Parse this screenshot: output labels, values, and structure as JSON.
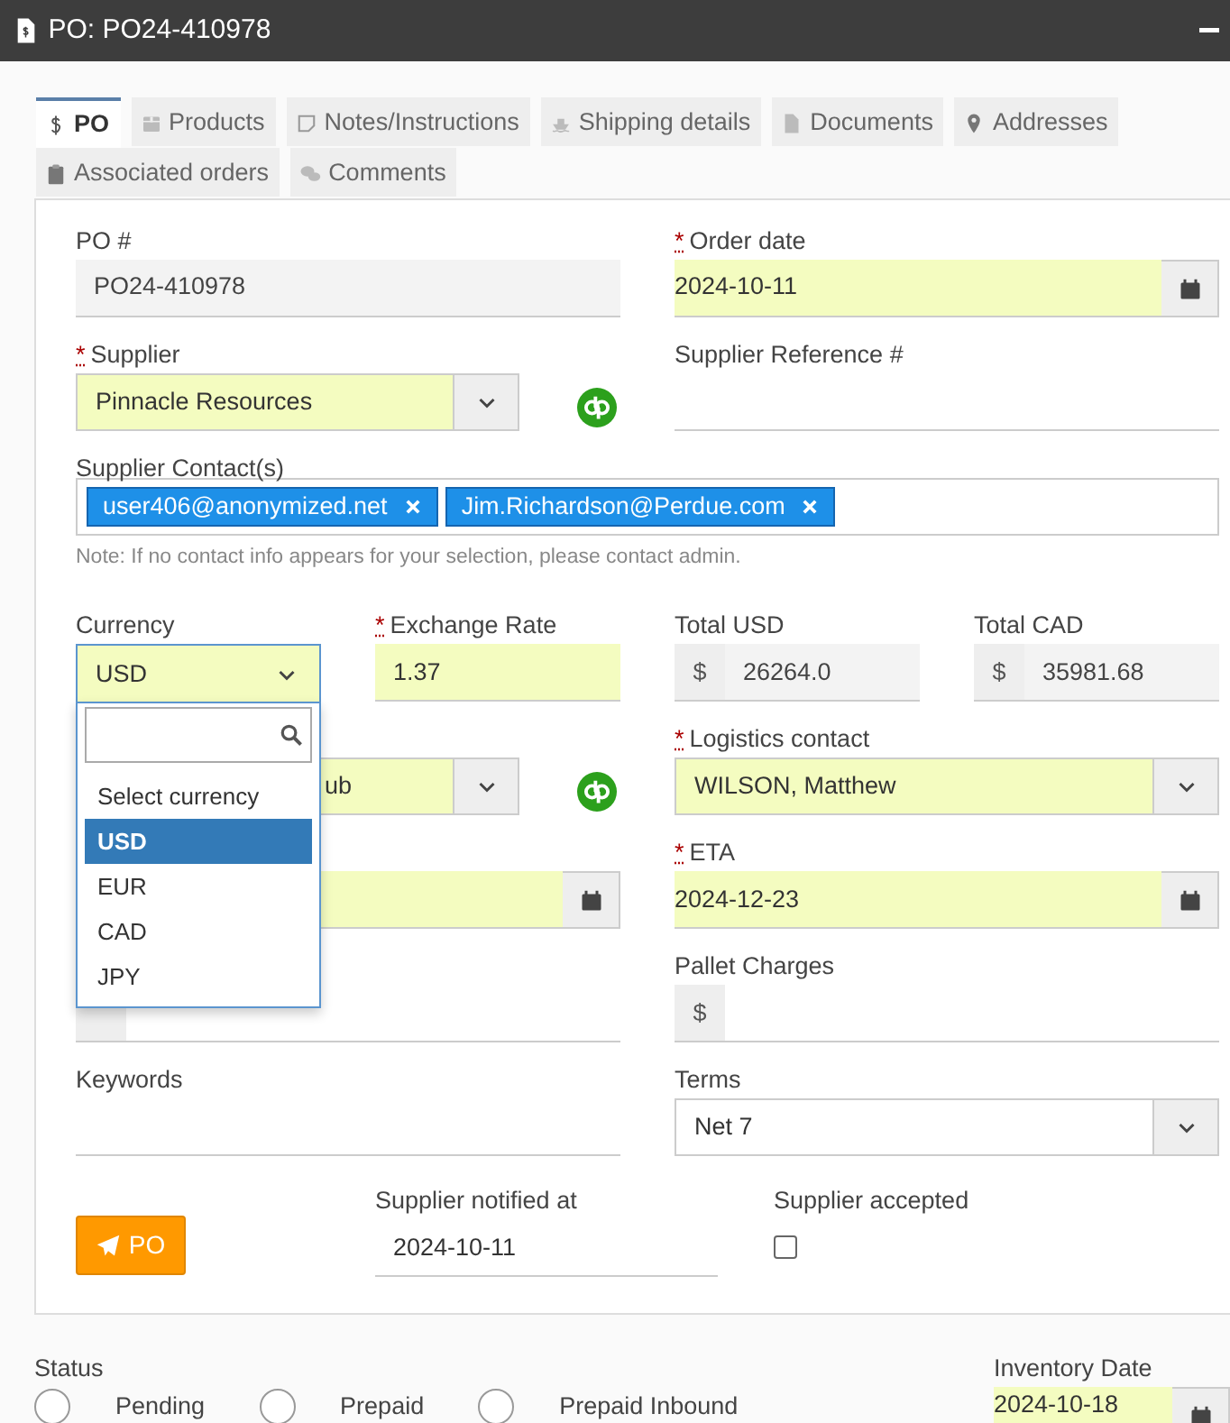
{
  "window": {
    "title": "PO: PO24-410978"
  },
  "tabs": [
    {
      "label": "PO",
      "selected": true
    },
    {
      "label": "Products",
      "selected": false
    },
    {
      "label": "Notes/Instructions",
      "selected": false
    },
    {
      "label": "Shipping details",
      "selected": false
    },
    {
      "label": "Documents",
      "selected": false
    },
    {
      "label": "Addresses",
      "selected": false
    },
    {
      "label": "Associated orders",
      "selected": false
    },
    {
      "label": "Comments",
      "selected": false
    }
  ],
  "form": {
    "po_number": {
      "label": "PO #",
      "value": "PO24-410978",
      "readonly": true
    },
    "order_date": {
      "label": "Order date",
      "value": "2024-10-11",
      "required_mark": "*",
      "highlighted": true
    },
    "supplier": {
      "label": "Supplier",
      "value": "Pinnacle Resources",
      "required_mark": "*",
      "highlighted": true
    },
    "supplier_reference": {
      "label": "Supplier Reference #"
    },
    "supplier_contacts": {
      "label": "Supplier Contact(s)",
      "tags": [
        "user406@anonymized.net",
        "Jim.Richardson@Perdue.com"
      ],
      "note": "Note: If no contact info appears for your selection, please contact admin."
    },
    "currency": {
      "label": "Currency",
      "value": "USD",
      "highlighted": true,
      "expanded": true,
      "options": [
        {
          "label": "Select currency",
          "selected": false
        },
        {
          "label": "USD",
          "selected": true
        },
        {
          "label": "EUR",
          "selected": false
        },
        {
          "label": "CAD",
          "selected": false
        },
        {
          "label": "JPY",
          "selected": false
        }
      ]
    },
    "exchange_rate": {
      "label": "Exchange Rate",
      "value": "1.37",
      "required_mark": "*",
      "highlighted": true
    },
    "total_usd": {
      "label": "Total USD",
      "prefix": "$",
      "value": "26264.0"
    },
    "total_cad": {
      "label": "Total CAD",
      "prefix": "$",
      "value": "35981.68"
    },
    "covered_select": {
      "value": "ub",
      "highlighted": true
    },
    "logistics_contact": {
      "label": "Logistics contact",
      "value": "WILSON, Matthew",
      "required_mark": "*",
      "highlighted": true
    },
    "covered_date": {
      "highlighted": true
    },
    "eta": {
      "label": "ETA",
      "value": "2024-12-23",
      "required_mark": "*",
      "highlighted": true
    },
    "pallet_charges": {
      "label": "Pallet Charges",
      "prefix": "$"
    },
    "keywords": {
      "label": "Keywords"
    },
    "terms": {
      "label": "Terms",
      "value": "Net 7",
      "highlighted": false
    },
    "send_button": {
      "label": "PO"
    },
    "supplier_notified_at": {
      "label": "Supplier notified at",
      "value": "2024-10-11"
    },
    "supplier_accepted": {
      "label": "Supplier accepted",
      "checked": false
    }
  },
  "status": {
    "label": "Status",
    "options": [
      {
        "label": "Pending",
        "selected": false
      },
      {
        "label": "Prepaid",
        "selected": false
      },
      {
        "label": "Prepaid Inbound",
        "selected": false
      }
    ]
  },
  "inventory_date": {
    "label": "Inventory Date",
    "value": "2024-10-18",
    "highlighted": true
  }
}
